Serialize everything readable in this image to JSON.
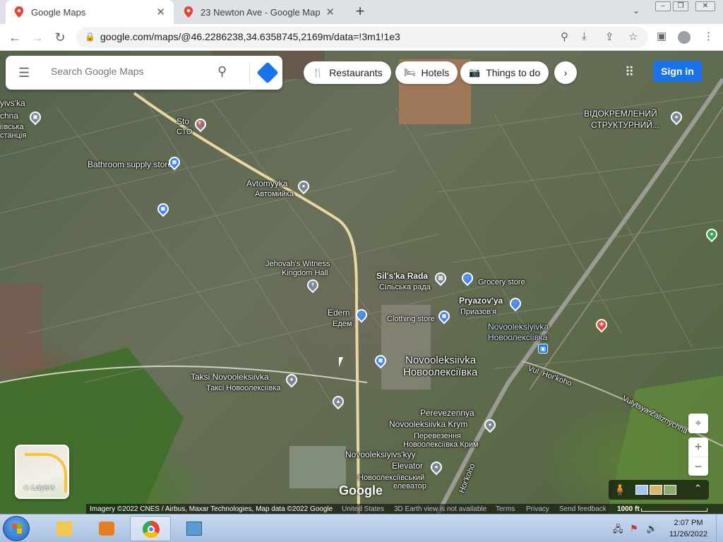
{
  "browser": {
    "tabs": [
      {
        "title": "Google Maps",
        "close": "✕"
      },
      {
        "title": "23 Newton Ave - Google Maps",
        "close": "✕"
      }
    ],
    "new_tab": "+",
    "url": "google.com/maps/@46.2286238,34.6358745,2169m/data=!3m1!1e3"
  },
  "search": {
    "placeholder": "Search Google Maps"
  },
  "chips": [
    {
      "label": "Restaurants",
      "icon": "fork-knife-icon"
    },
    {
      "label": "Hotels",
      "icon": "bed-icon"
    },
    {
      "label": "Things to do",
      "icon": "camera-icon"
    }
  ],
  "header": {
    "sign_in": "Sign in"
  },
  "map_labels": {
    "sto_top": "Sto",
    "sto_bottom": "СТО",
    "bathroom": "Bathroom supply store",
    "avtomyyka": "Avtomyyka",
    "avtomyyka_ua": "Автомийка",
    "jehovah_1": "Jehovah's Witness",
    "jehovah_2": "Kingdom Hall",
    "edem": "Edem",
    "edem_ua": "Едем",
    "silska": "Sil's'ka Rada",
    "silska_ua": "Сільська рада",
    "grocery": "Grocery store",
    "clothing": "Clothing store",
    "pryazovya": "Pryazov'ya",
    "pryazovya_ua": "Приазов'я",
    "novo_station": "Novooleksiyivka",
    "novo_station_ua": "Новоолексіївка",
    "town": "Novooleksiivka",
    "town_ua": "Новоолексіївка",
    "taksi": "Taksi Novooleksiivka",
    "taksi_ua": "Таксі Новоолексіївка",
    "perev_1": "Perevezennya",
    "perev_2": "Novooleksiivka Krym",
    "perev_ua1": "Перевезення",
    "perev_ua2": "Новоолексіївка Крим",
    "elev_1": "Novooleksiyivs'kyy",
    "elev_2": "Elevator",
    "elev_ua1": "Новоолексіївський",
    "elev_ua2": "елеватор",
    "vidokr_1": "ВІДОКРЕМЛЕНИЙ",
    "vidokr_2": "СТРУКТУРНИЙ...",
    "left_1": "yivs'ka",
    "left_2": "chna",
    "left_3": "іївська",
    "left_4": "станція",
    "street_hor": "Vul. Hor'koho",
    "street_hor2": "Hor'koho",
    "street_zal": "Vulytsya Zaliznychna"
  },
  "controls": {
    "layers": "Layers",
    "zoom_in": "+",
    "zoom_out": "−",
    "google": "Google"
  },
  "attribution": {
    "imagery": "Imagery ©2022 CNES / Airbus, Maxar Technologies, Map data ©2022 Google",
    "country": "United States",
    "earth": "3D Earth view is not available",
    "terms": "Terms",
    "privacy": "Privacy",
    "feedback": "Send feedback",
    "scale": "1000 ft"
  },
  "taskbar": {
    "time": "2:07 PM",
    "date": "11/26/2022"
  },
  "colors": {
    "accent": "#1a73e8",
    "pin_blue": "#4285f4",
    "pin_gray": "#7b8794",
    "pin_green": "#34a853",
    "pin_red": "#ea4335"
  }
}
